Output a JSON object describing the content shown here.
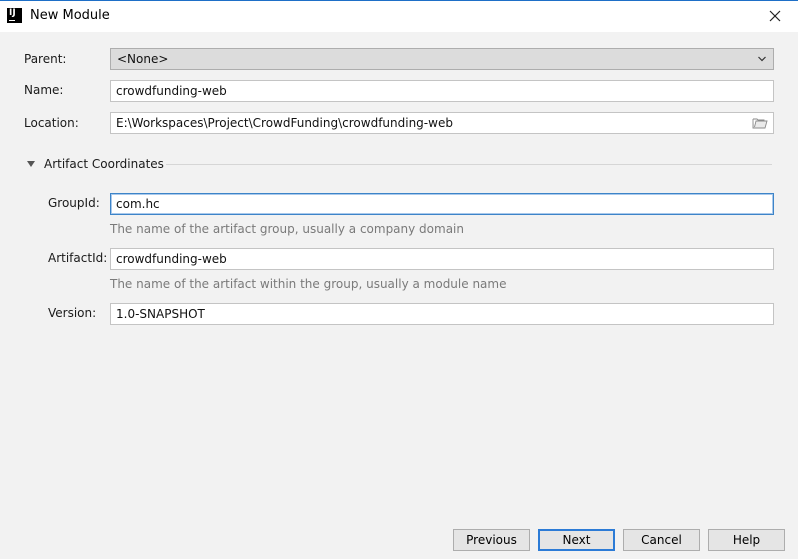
{
  "window": {
    "title": "New Module"
  },
  "form": {
    "parent_label": "Parent:",
    "parent_value": "<None>",
    "name_label": "Name:",
    "name_value": "crowdfunding-web",
    "location_label": "Location:",
    "location_value": "E:\\Workspaces\\Project\\CrowdFunding\\crowdfunding-web"
  },
  "artifact": {
    "section_title": "Artifact Coordinates",
    "groupid_label": "GroupId:",
    "groupid_value": "com.hc",
    "groupid_hint": "The name of the artifact group, usually a company domain",
    "artifactid_label": "ArtifactId:",
    "artifactid_value": "crowdfunding-web",
    "artifactid_hint": "The name of the artifact within the group, usually a module name",
    "version_label": "Version:",
    "version_value": "1.0-SNAPSHOT"
  },
  "buttons": {
    "previous_first": "P",
    "previous_rest": "revious",
    "next_first": "N",
    "next_rest": "ext",
    "cancel": "Cancel",
    "help": "Help"
  },
  "colors": {
    "accent": "#2c7bd6",
    "background": "#f2f2f2"
  },
  "icons": [
    "app-icon",
    "close-icon",
    "chevron-down-icon",
    "folder-icon",
    "expand-triangle-icon"
  ]
}
